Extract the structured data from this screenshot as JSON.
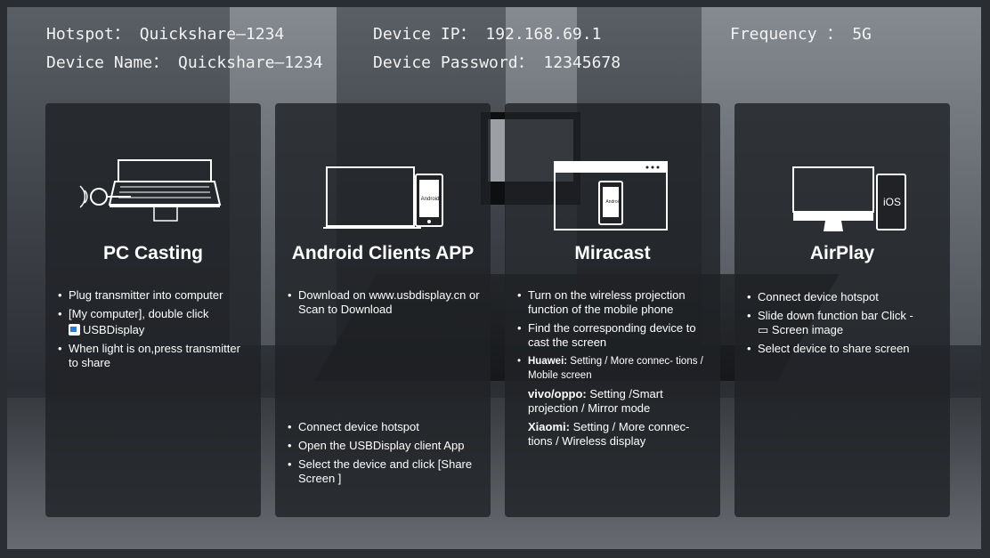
{
  "header": {
    "hotspot": "Hotspot： Quickshare—1234",
    "device_name": "Device Name： Quickshare—1234",
    "device_ip": "Device IP： 192.168.69.1",
    "device_password": "Device Password： 12345678",
    "frequency": "Frequency ： 5G"
  },
  "panels": {
    "pc": {
      "title": "PC Casting",
      "items": [
        "Plug transmitter into computer",
        "[My computer], double click",
        "USBDisplay",
        "When light is on,press transmitter to share"
      ]
    },
    "android": {
      "title": "Android Clients APP",
      "screen_label": "Android",
      "items_top": [
        "Download on www.usbdisplay.cn or Scan to Download"
      ],
      "items_bottom": [
        "Connect device hotspot",
        "Open the USBDisplay client App",
        "Select the device and click [Share Screen ]"
      ]
    },
    "miracast": {
      "title": "Miracast",
      "screen_label": "Android",
      "items": [
        "Turn on the wireless projection function of the mobile phone",
        "Find the corresponding device to cast the screen"
      ],
      "huawei_brand": "Huawei:",
      "huawei_text": " Setting  / More connec- tions / Mobile screen",
      "vivo_brand": "vivo/oppo:",
      "vivo_text": " Setting  /Smart projection / Mirror mode",
      "xiaomi_brand": "Xiaomi:",
      "xiaomi_text": " Setting  / More connec- tions / Wireless display"
    },
    "airplay": {
      "title": "AirPlay",
      "ios_label": "iOS",
      "items": [
        "Connect device hotspot",
        "Slide down function bar Click -",
        "Screen image",
        "Select device to share screen"
      ]
    }
  }
}
